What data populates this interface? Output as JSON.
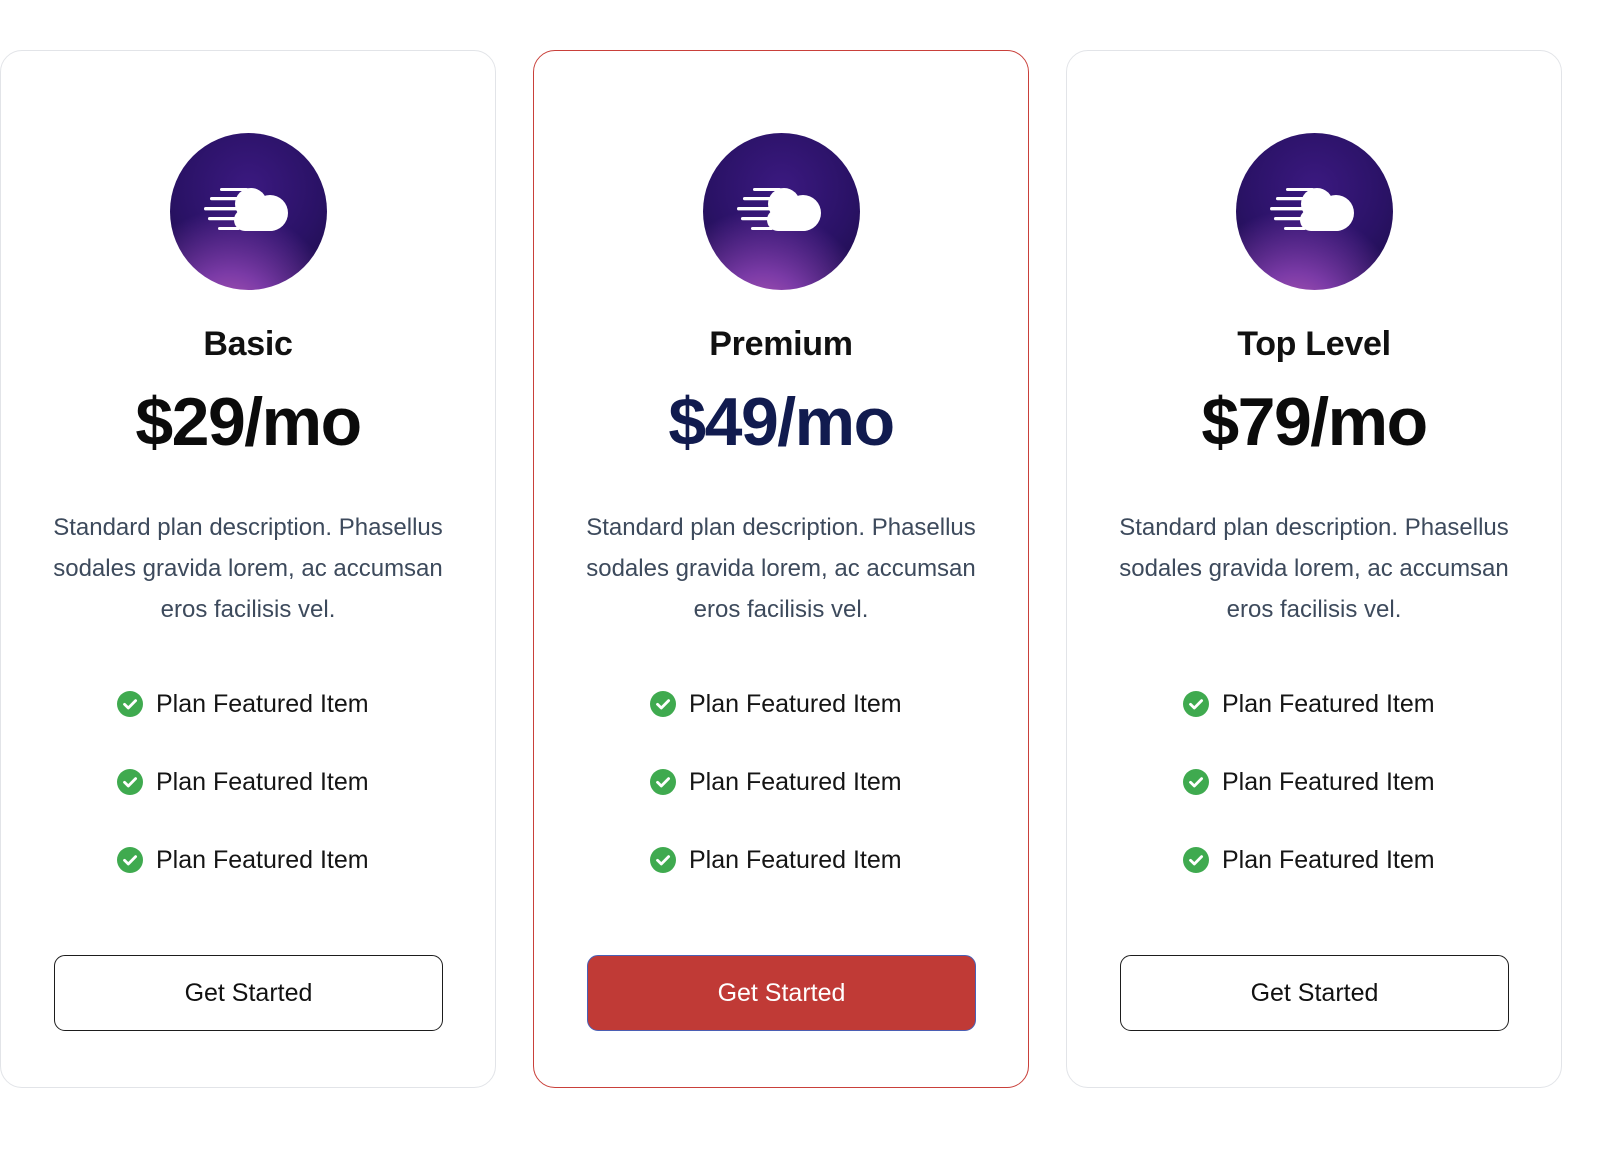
{
  "colors": {
    "featured_border": "#c9403a",
    "featured_button": "#c03a36",
    "featured_price": "#111b4f",
    "check": "#3faa4f",
    "description": "#3d4a5c"
  },
  "plans": [
    {
      "icon": "cloud-speed-logo-icon",
      "name": "Basic",
      "price": "$29/mo",
      "description": "Standard plan description. Phasellus sodales gravida lorem, ac accumsan eros facilisis vel.",
      "features": [
        "Plan Featured Item",
        "Plan Featured Item",
        "Plan Featured Item"
      ],
      "cta": "Get Started",
      "featured": false
    },
    {
      "icon": "cloud-speed-logo-icon",
      "name": "Premium",
      "price": "$49/mo",
      "description": "Standard plan description. Phasellus sodales gravida lorem, ac accumsan eros facilisis vel.",
      "features": [
        "Plan Featured Item",
        "Plan Featured Item",
        "Plan Featured Item"
      ],
      "cta": "Get Started",
      "featured": true
    },
    {
      "icon": "cloud-speed-logo-icon",
      "name": "Top Level",
      "price": "$79/mo",
      "description": "Standard plan description. Phasellus sodales gravida lorem, ac accumsan eros facilisis vel.",
      "features": [
        "Plan Featured Item",
        "Plan Featured Item",
        "Plan Featured Item"
      ],
      "cta": "Get Started",
      "featured": false
    }
  ]
}
